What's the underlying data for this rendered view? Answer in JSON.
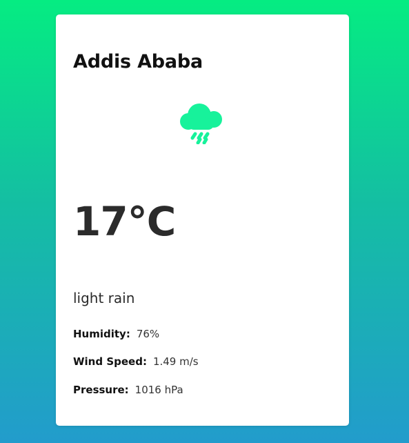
{
  "city": "Addis Ababa",
  "weather": {
    "icon": "cloud-rain-icon",
    "icon_color": "#17f29b",
    "temperature": "17°C",
    "description": "light rain"
  },
  "details": {
    "humidity_label": "Humidity:",
    "humidity_value": "76%",
    "wind_label": "Wind Speed:",
    "wind_value": "1.49 m/s",
    "pressure_label": "Pressure:",
    "pressure_value": "1016 hPa"
  },
  "colors": {
    "background_top": "#05ec82",
    "background_bottom": "#229ccc",
    "card": "#ffffff"
  }
}
